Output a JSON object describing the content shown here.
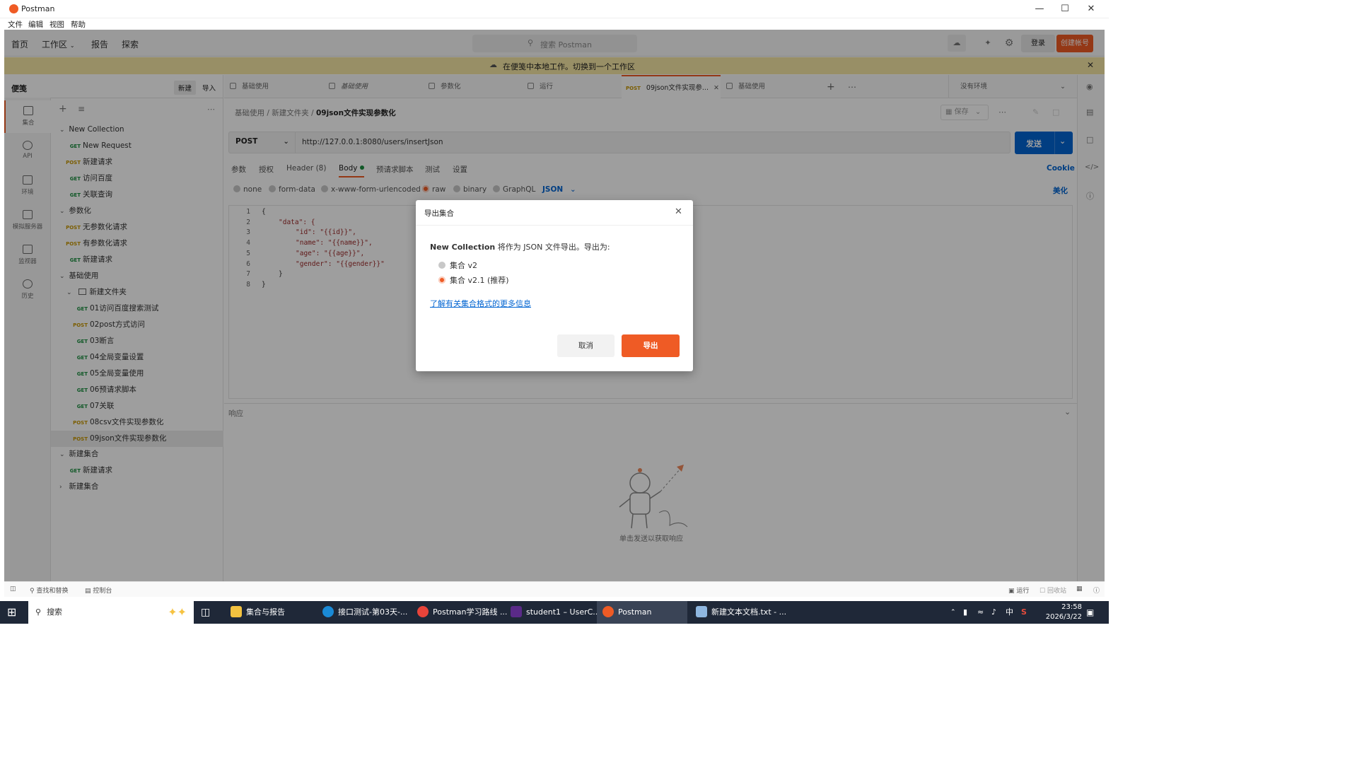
{
  "window": {
    "title": "Postman",
    "menu": [
      "文件",
      "编辑",
      "视图",
      "帮助"
    ]
  },
  "header": {
    "nav": [
      "首页",
      "工作区",
      "报告",
      "探索"
    ],
    "search_placeholder": "搜索 Postman",
    "login": "登录",
    "signup": "创建帐号"
  },
  "banner": {
    "text": "在便笺中本地工作。切换到一个工作区"
  },
  "sidebar": {
    "title": "便笺",
    "new": "新建",
    "import": "导入",
    "rail": [
      "集合",
      "API",
      "环境",
      "模拟服务器",
      "监视器",
      "历史"
    ],
    "tree": [
      {
        "label": "New Collection"
      },
      {
        "method": "GET",
        "label": "New Request"
      },
      {
        "method": "POST",
        "label": "新建请求"
      },
      {
        "method": "GET",
        "label": "访问百度"
      },
      {
        "method": "GET",
        "label": "关联查询"
      },
      {
        "label": "参数化"
      },
      {
        "method": "POST",
        "label": "无参数化请求"
      },
      {
        "method": "POST",
        "label": "有参数化请求"
      },
      {
        "method": "GET",
        "label": "新建请求"
      },
      {
        "label": "基础使用"
      },
      {
        "label": "新建文件夹"
      },
      {
        "method": "GET",
        "label": "01访问百度搜索测试"
      },
      {
        "method": "POST",
        "label": "02post方式访问"
      },
      {
        "method": "GET",
        "label": "03断言"
      },
      {
        "method": "GET",
        "label": "04全局变量设置"
      },
      {
        "method": "GET",
        "label": "05全局变量使用"
      },
      {
        "method": "GET",
        "label": "06预请求脚本"
      },
      {
        "method": "GET",
        "label": "07关联"
      },
      {
        "method": "POST",
        "label": "08csv文件实现参数化"
      },
      {
        "method": "POST",
        "label": "09json文件实现参数化"
      },
      {
        "label": "新建集合"
      },
      {
        "method": "GET",
        "label": "新建请求"
      },
      {
        "label": "新建集合"
      }
    ]
  },
  "tabs": [
    {
      "label": "基础使用"
    },
    {
      "label": "基础使用"
    },
    {
      "label": "参数化"
    },
    {
      "label": "运行"
    },
    {
      "method": "POST",
      "label": "09json文件实现参..."
    },
    {
      "label": "基础使用"
    }
  ],
  "environment": "没有环境",
  "request": {
    "breadcrumb": [
      "基础使用",
      "新建文件夹",
      "09json文件实现参数化"
    ],
    "save": "保存",
    "method": "POST",
    "url": "http://127.0.0.1:8080/users/insertJson",
    "send": "发送",
    "tabs": [
      "参数",
      "授权",
      "Header (8)",
      "Body",
      "预请求脚本",
      "测试",
      "设置"
    ],
    "cookie": "Cookie",
    "body_types": [
      "none",
      "form-data",
      "x-www-form-urlencoded",
      "raw",
      "binary",
      "GraphQL"
    ],
    "format": "JSON",
    "beautify": "美化",
    "code_lines": [
      "{",
      "\"data\": {",
      "\"id\": \"{{id}}\",",
      "\"name\": \"{{name}}\",",
      "\"age\": \"{{age}}\",",
      "\"gender\": \"{{gender}}\"",
      "}",
      "}"
    ]
  },
  "response": {
    "label": "响应",
    "empty": "单击发送以获取响应"
  },
  "modal": {
    "title": "导出集合",
    "collection": "New Collection",
    "message": " 将作为 JSON 文件导出。导出为:",
    "option1": "集合 v2",
    "option2": "集合 v2.1 (推荐)",
    "link": "了解有关集合格式的更多信息",
    "cancel": "取消",
    "export": "导出"
  },
  "statusbar": {
    "find": "查找和替换",
    "console": "控制台",
    "runner": "运行",
    "trash": "回收站"
  },
  "taskbar": {
    "search": "搜索",
    "apps": [
      "集合与报告",
      "接口测试-第03天-...",
      "Postman学习路线 ...",
      "student1 – UserC...",
      "Postman",
      "新建文本文档.txt - ..."
    ],
    "ime": "中",
    "time": "23:58",
    "date": "2026/3/22"
  },
  "colors": {
    "accent": "#ef5b25",
    "send_blue": "#0265d2",
    "banner": "#f6e7a5",
    "taskbar": "#1f2838"
  }
}
